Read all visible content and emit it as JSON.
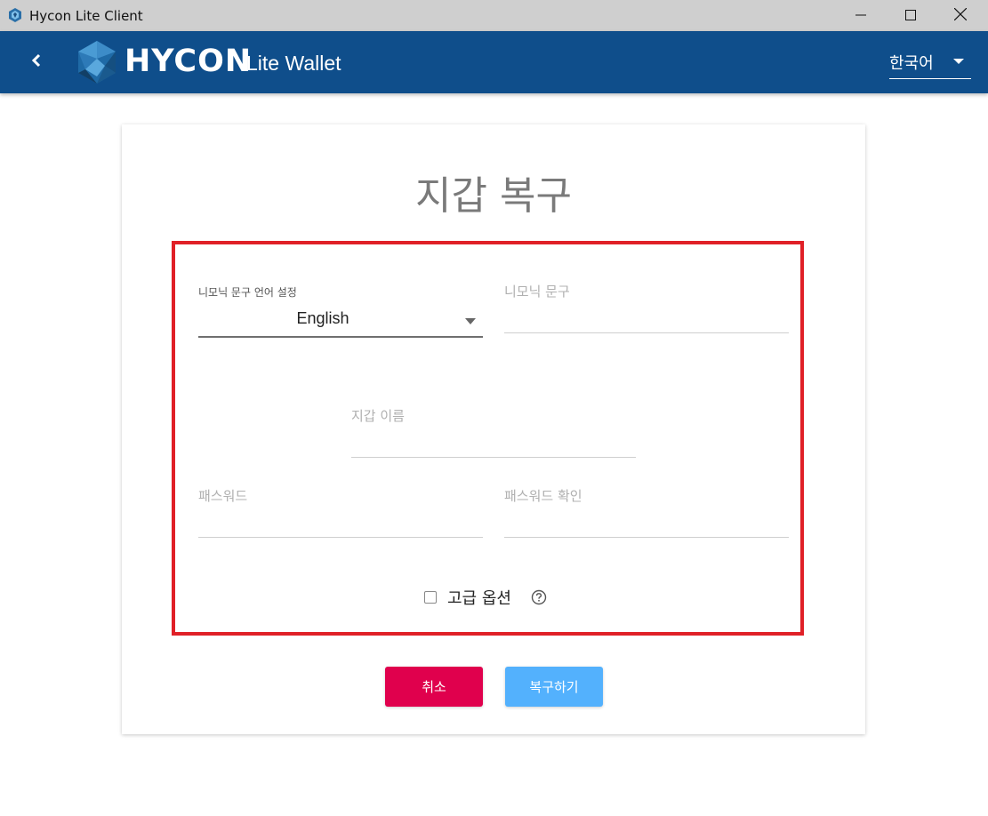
{
  "window": {
    "title": "Hycon Lite Client",
    "icons": [
      "app-icon",
      "minimize-icon",
      "maximize-icon",
      "close-icon"
    ]
  },
  "appbar": {
    "logo_text": "HYCON",
    "logo_sub": "Lite Wallet",
    "language": "한국어",
    "background": "#0f4e8b"
  },
  "form": {
    "title": "지갑 복구",
    "mnemonic_language_label": "니모닉 문구 언어 설정",
    "mnemonic_language_value": "English",
    "mnemonic_label": "니모닉 문구",
    "wallet_name_label": "지갑 이름",
    "password_label": "패스워드",
    "password_confirm_label": "패스워드 확인",
    "advanced_label": "고급 옵션",
    "advanced_checked": false,
    "cancel_label": "취소",
    "restore_label": "복구하기",
    "colors": {
      "cancel": "#e0004d",
      "restore": "#53b1fd",
      "highlight": "#e02027"
    }
  }
}
